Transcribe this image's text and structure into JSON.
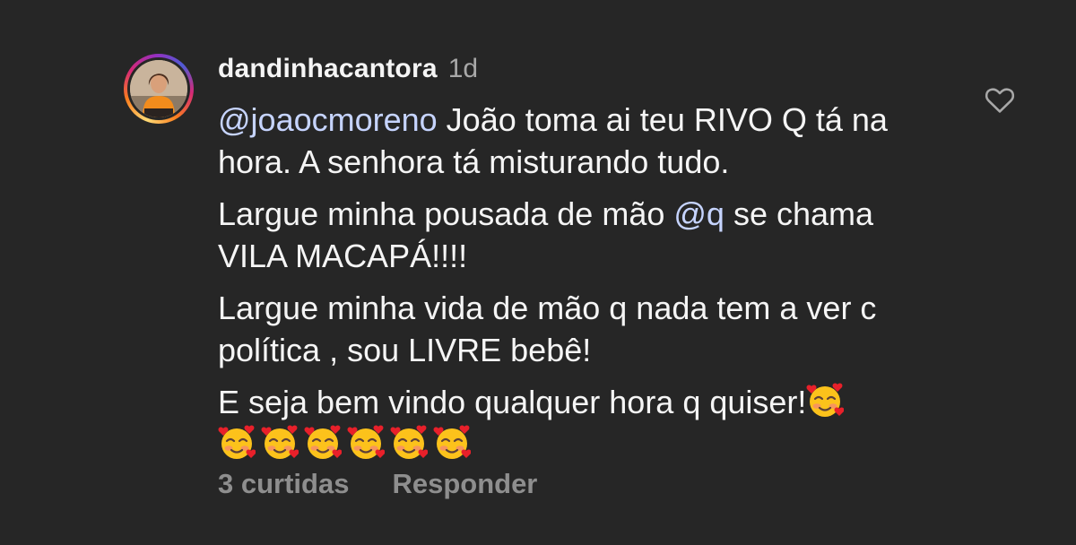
{
  "comment": {
    "author": {
      "username": "dandinhacantora",
      "time_ago": "1d",
      "avatar_icon": "profile-photo",
      "story_ring_colors": [
        "#feda75",
        "#fa7e1e",
        "#d62976",
        "#962fbf",
        "#4f5bd5"
      ]
    },
    "paragraphs": {
      "p1": {
        "mention": "@joaocmoreno",
        "text": " João toma ai teu RIVO Q tá na hora. A senhora tá misturando tudo."
      },
      "p2": {
        "text_before": "Largue minha pousada de mão ",
        "mention": "@q",
        "text_after": " se chama VILA MACAPÁ!!!!"
      },
      "p3": {
        "text": "Largue minha vida de mão q nada tem a ver c política , sou LIVRE bebê!"
      },
      "p4": {
        "text": "E seja bem vindo qualquer hora q quiser!"
      }
    },
    "emoji": {
      "name": "smiling-face-with-hearts",
      "trailing_count": 1,
      "row_count": 6
    },
    "like_icon": "heart-outline",
    "actions": {
      "likes": "3 curtidas",
      "reply": "Responder"
    }
  },
  "colors": {
    "background": "#262626",
    "text": "#f5f5f5",
    "mention": "#c6d4ff",
    "secondary": "#a8a8a8",
    "action": "#8e8e8e"
  }
}
